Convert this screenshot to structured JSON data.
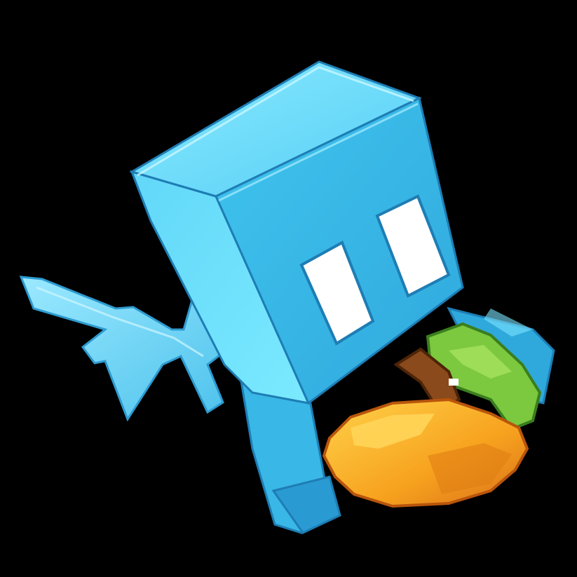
{
  "scene": {
    "background": "#000000",
    "subject": "allay-icon",
    "held_item": "orange-fruit-icon",
    "palette": {
      "body_light": "#7FE6FF",
      "body_mid": "#3DC2EE",
      "body_dark": "#1E8FC6",
      "outline": "#1A6FA8",
      "eye": "#FFFFFF",
      "wing": "#6FD4F2",
      "fruit_light": "#FFC43A",
      "fruit_mid": "#F7A21E",
      "fruit_dark": "#C85F0E",
      "leaf_light": "#8BD24A",
      "leaf_dark": "#3E8A22",
      "stem": "#6B3A18"
    }
  }
}
